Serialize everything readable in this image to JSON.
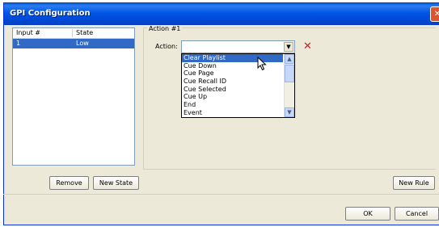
{
  "window": {
    "title": "GPI Configuration",
    "close_glyph": "✕"
  },
  "inputs_list": {
    "columns": [
      "Input #",
      "State"
    ],
    "rows": [
      {
        "input": "1",
        "state": "Low"
      }
    ]
  },
  "action_group": {
    "legend": "Action #1",
    "action_label": "Action:",
    "action_value": "",
    "dropdown_options": [
      "Clear Playlist",
      "Cue Down",
      "Cue Page",
      "Cue Recall ID",
      "Cue Selected",
      "Cue Up",
      "End",
      "Event"
    ],
    "highlighted_option": "Clear Playlist"
  },
  "buttons": {
    "remove": "Remove",
    "new_state": "New State",
    "new_rule": "New Rule",
    "ok": "OK",
    "cancel": "Cancel"
  },
  "icons": {
    "delete_glyph": "✕",
    "dropdown_arrow": "▼",
    "scroll_up": "▲",
    "scroll_down": "▼"
  },
  "colors": {
    "titlebar": "#0055e5",
    "selection": "#3169c6",
    "delete": "#d32020"
  }
}
